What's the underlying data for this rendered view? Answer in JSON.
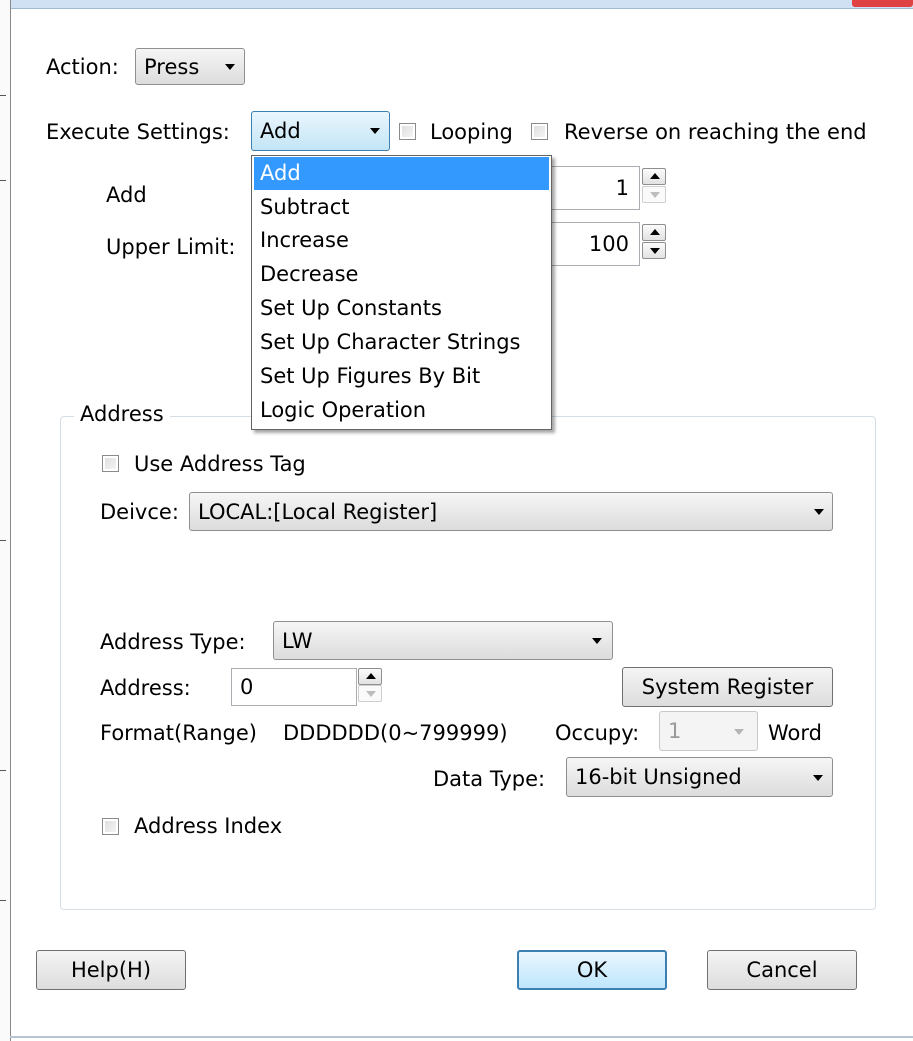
{
  "action": {
    "label": "Action:",
    "value": "Press"
  },
  "execute": {
    "label": "Execute Settings:",
    "value": "Add",
    "looping_label": "Looping",
    "reverse_label": "Reverse on reaching the end",
    "options": [
      "Add",
      "Subtract",
      "Increase",
      "Decrease",
      "Set Up Constants",
      "Set Up Character Strings",
      "Set Up Figures By Bit",
      "Logic Operation"
    ],
    "selected_index": 0
  },
  "add_field": {
    "label": "Add",
    "value": "1"
  },
  "upper_limit": {
    "label": "Upper Limit:",
    "value": "100"
  },
  "address_group": {
    "title": "Address",
    "use_tag_label": "Use Address Tag",
    "device_label": "Deivce:",
    "device_value": "LOCAL:[Local Register]",
    "address_type_label": "Address Type:",
    "address_type_value": "LW",
    "address_label": "Address:",
    "address_value": "0",
    "system_register_label": "System Register",
    "format_label": "Format(Range)",
    "format_value": "DDDDDD(0~799999)",
    "occupy_label": "Occupy:",
    "occupy_value": "1",
    "occupy_unit": "Word",
    "data_type_label": "Data Type:",
    "data_type_value": "16-bit Unsigned",
    "address_index_label": "Address Index"
  },
  "buttons": {
    "help": "Help(H)",
    "ok": "OK",
    "cancel": "Cancel"
  },
  "colors": {
    "selection": "#3399ff",
    "default_button_border": "#3c7fb1"
  }
}
